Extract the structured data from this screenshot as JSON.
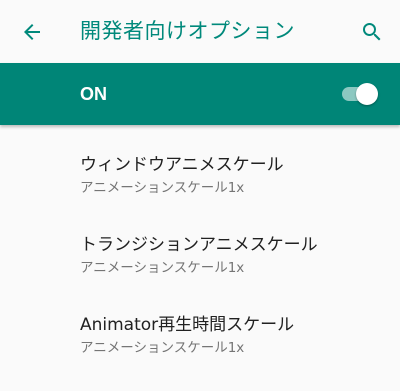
{
  "appbar": {
    "title": "開発者向けオプション",
    "back_icon": "arrow-back-icon",
    "search_icon": "search-icon",
    "accent_color": "#00897b"
  },
  "master_switch": {
    "label": "ON",
    "state": "on",
    "bar_color": "#008577"
  },
  "preferences": [
    {
      "title": "ウィンドウアニメスケール",
      "summary": "アニメーションスケール1x"
    },
    {
      "title": "トランジションアニメスケール",
      "summary": "アニメーションスケール1x"
    },
    {
      "title": "Animator再生時間スケール",
      "summary": "アニメーションスケール1x"
    }
  ]
}
